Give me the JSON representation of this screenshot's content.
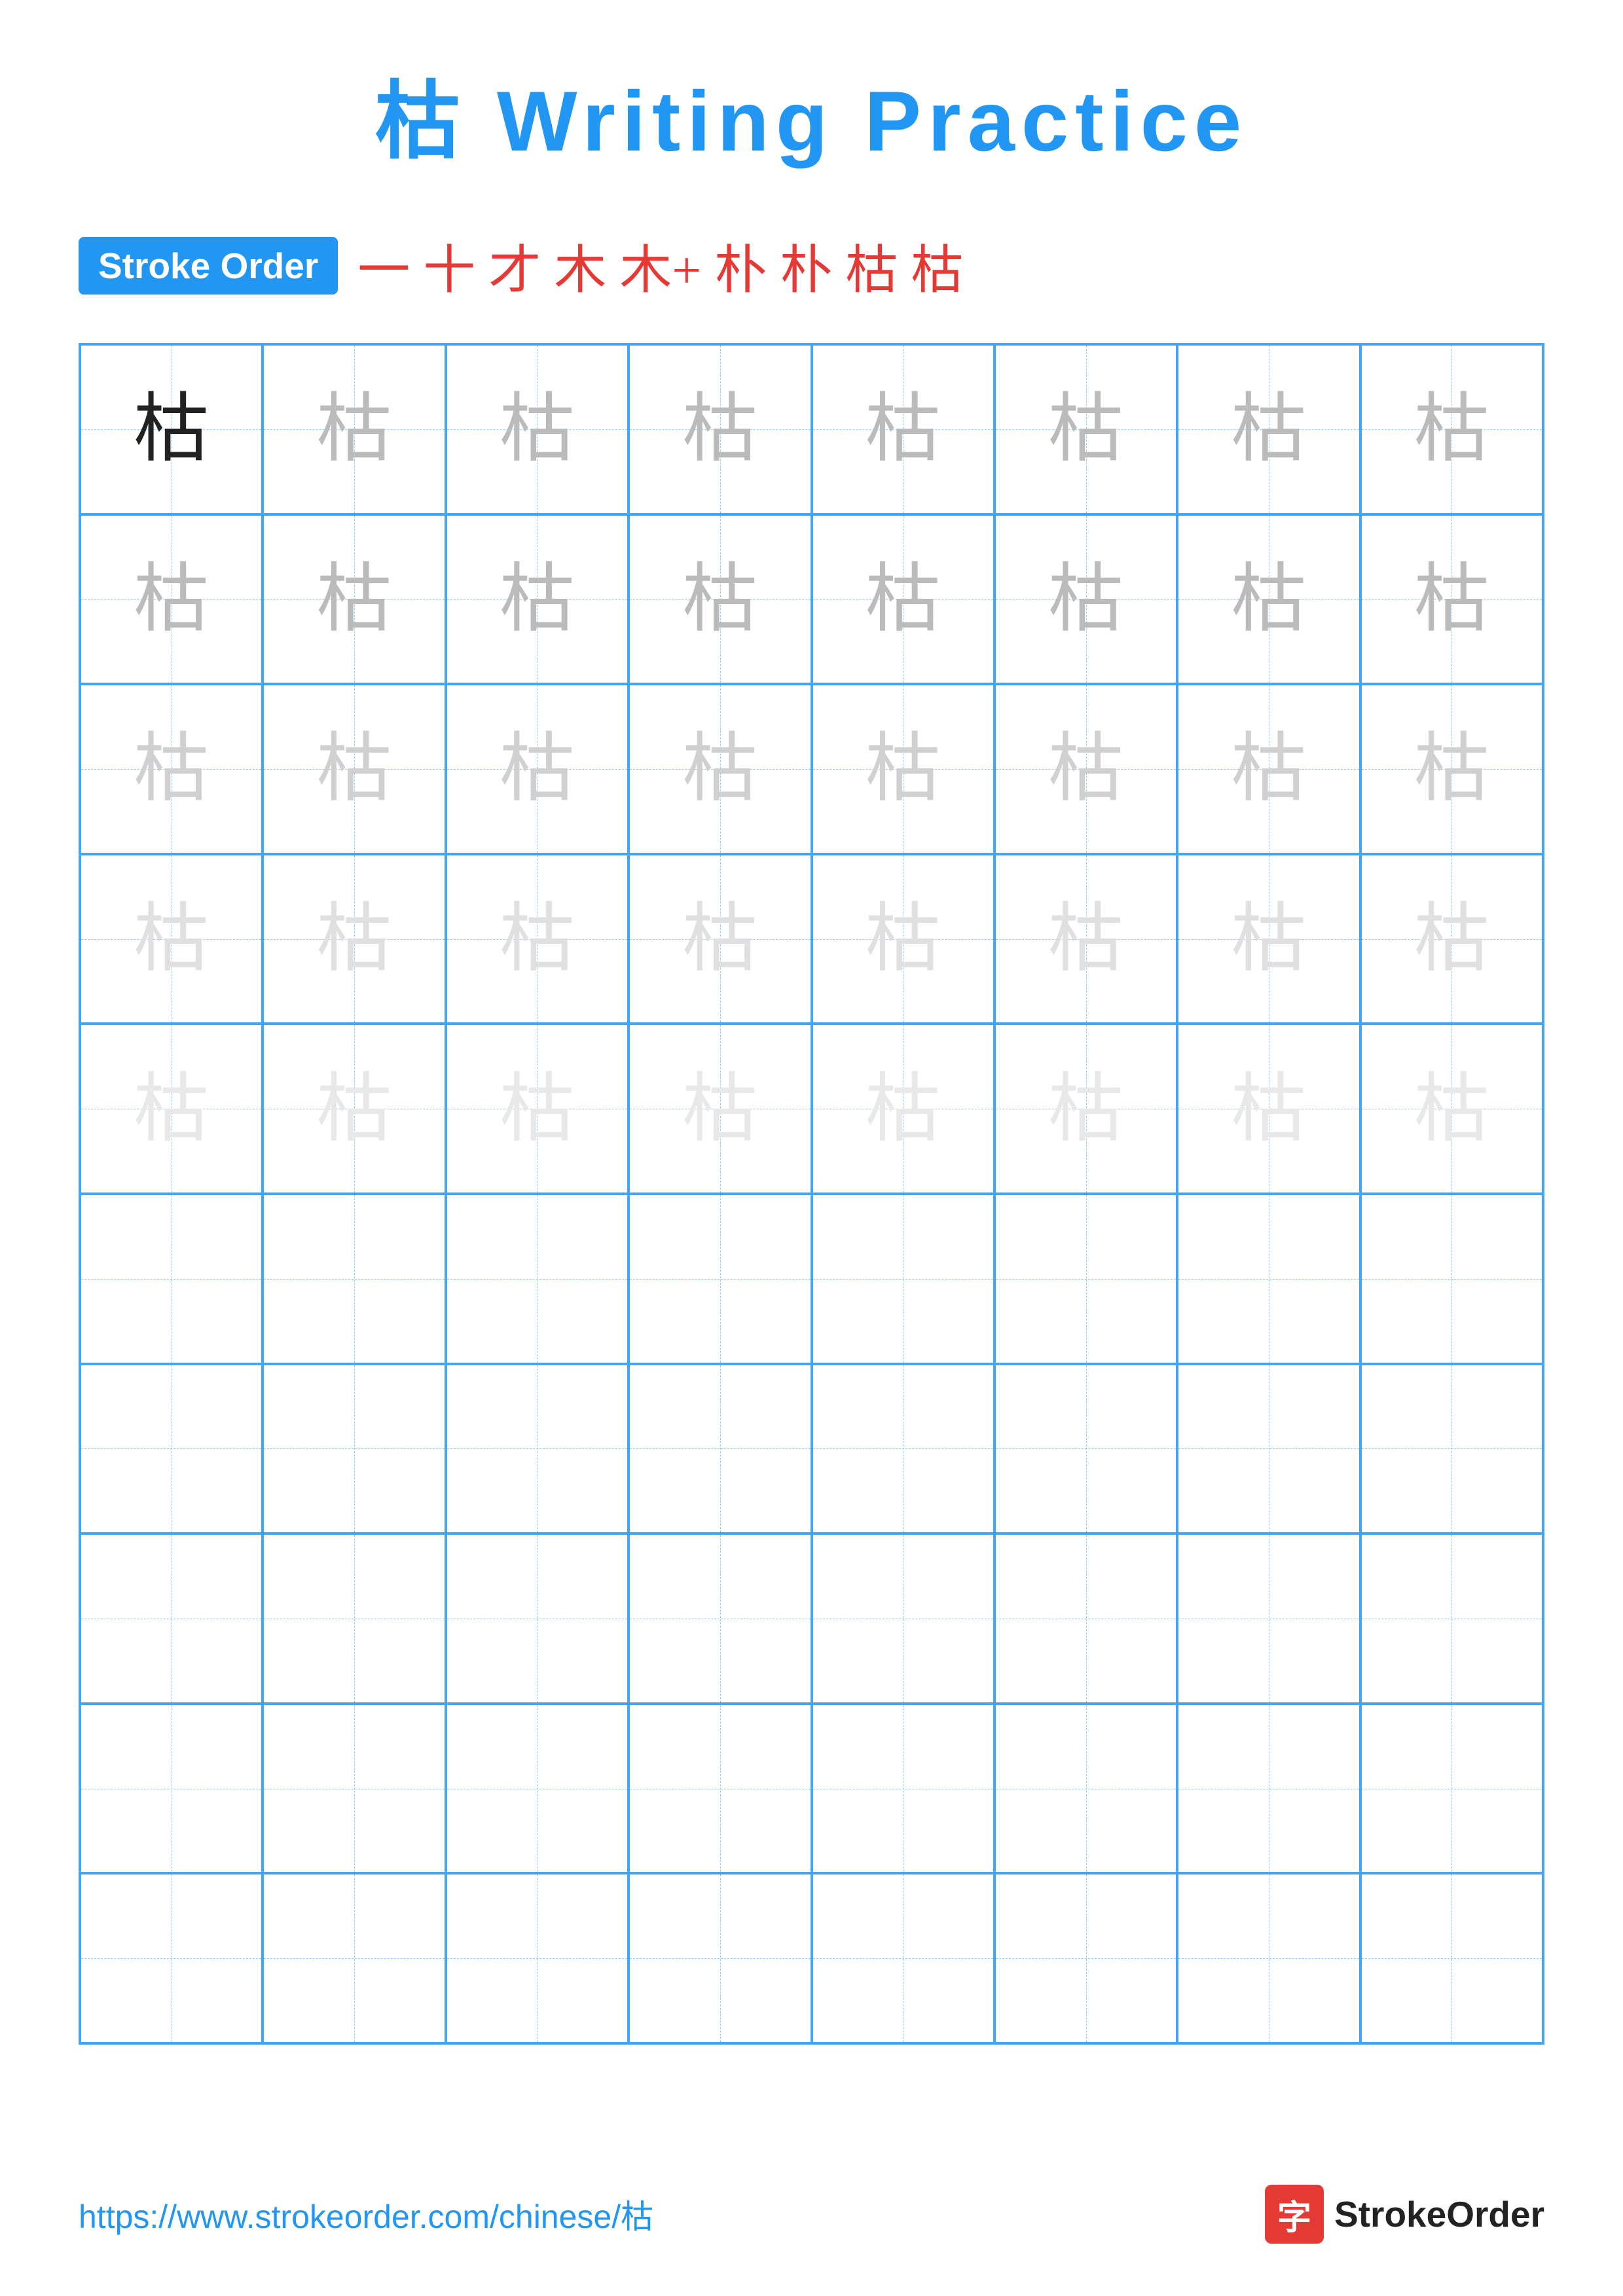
{
  "title": {
    "character": "枯",
    "text": "Writing Practice",
    "full_title": "枯 Writing Practice"
  },
  "stroke_order": {
    "badge_label": "Stroke Order",
    "strokes": [
      "一",
      "十",
      "才",
      "木",
      "木+",
      "朴",
      "朴",
      "枯",
      "枯"
    ]
  },
  "grid": {
    "cols": 8,
    "rows": 10,
    "character": "枯",
    "row_opacities": [
      "dark",
      "medium-light",
      "light",
      "very-light",
      "ultra-light",
      "",
      "",
      "",
      "",
      ""
    ]
  },
  "footer": {
    "url": "https://www.strokeorder.com/chinese/枯",
    "logo_char": "字",
    "logo_text": "StrokeOrder"
  }
}
